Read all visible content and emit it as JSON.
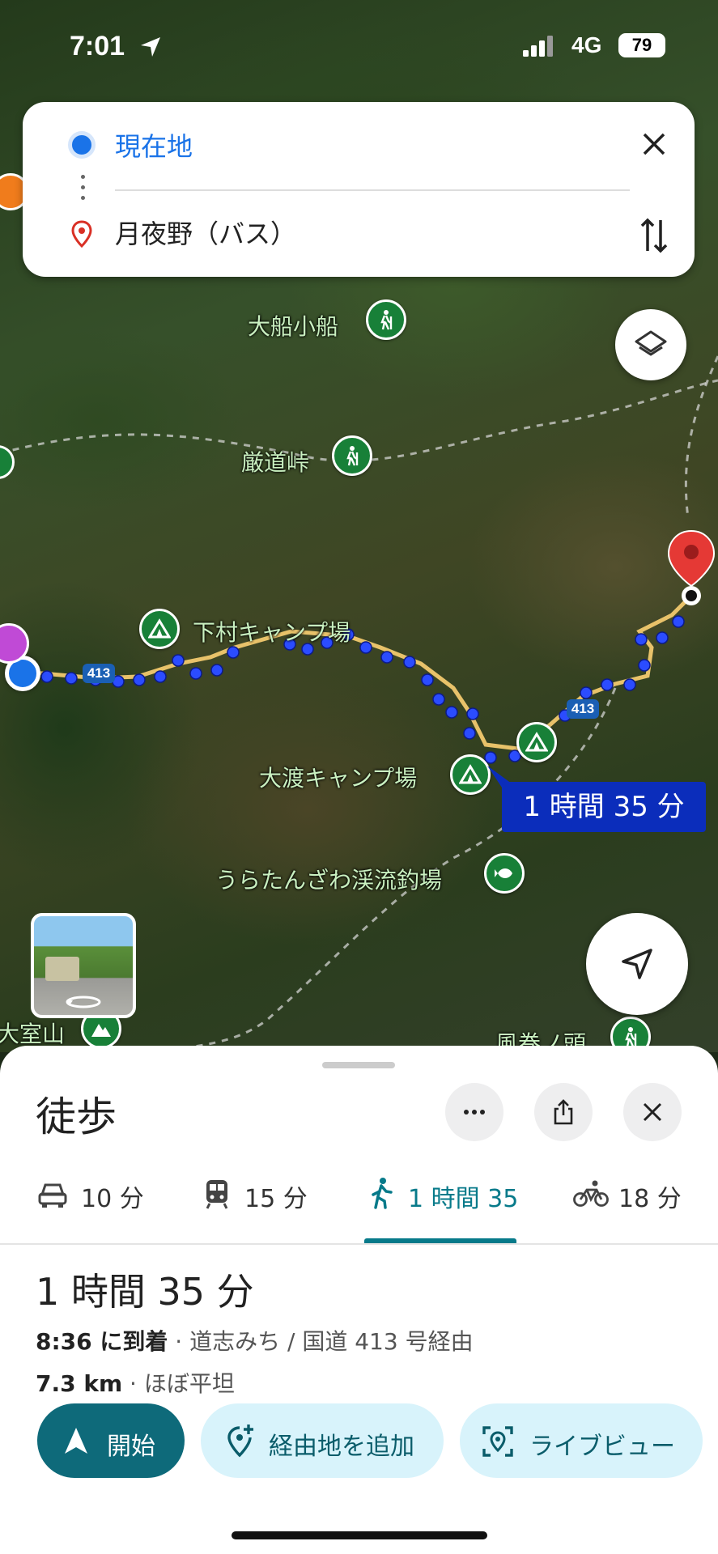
{
  "status_bar": {
    "time": "7:01",
    "network": "4G",
    "battery": "79"
  },
  "search": {
    "origin": "現在地",
    "destination": "月夜野（バス）"
  },
  "map": {
    "labels": {
      "oofune": "大船小船",
      "gando": "厳道峠",
      "shimomura": "下村キャンプ場",
      "oowatari": "大渡キャンプ場",
      "uratanzawa": "うらたんざわ渓流釣場",
      "oomuro": "大室山",
      "kazamaki": "風巻ノ頭"
    },
    "road_number": "413",
    "route_duration": "1 時間 35 分"
  },
  "sheet": {
    "title": "徒歩",
    "tabs": [
      {
        "mode": "car-icon",
        "label": "10 分"
      },
      {
        "mode": "transit-icon",
        "label": "15 分"
      },
      {
        "mode": "walk-icon",
        "label": "1 時間 35"
      },
      {
        "mode": "bike-icon",
        "label": "18 分"
      }
    ],
    "selected_tab": 2,
    "duration": "1 時間 35 分",
    "arrival_time": "8:36 に到着",
    "via": " · 道志みち / 国道 413 号経由",
    "distance": "7.3 km",
    "terrain": " · ほぼ平坦",
    "buttons": {
      "start": "開始",
      "add_stop": "経由地を追加",
      "live_view": "ライブビュー"
    }
  },
  "colors": {
    "accent": "#077a8a",
    "route": "#1a3fff",
    "link_blue": "#1a73e8",
    "poi_green": "#188038",
    "dest_red": "#d93025"
  }
}
